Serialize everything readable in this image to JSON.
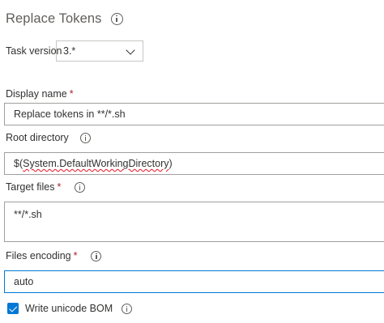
{
  "header": {
    "title": "Replace Tokens",
    "info_icon": "info-icon"
  },
  "task_version": {
    "label": "Task version",
    "value": "3.*",
    "chevron_icon": "chevron-down-icon"
  },
  "display_name": {
    "label": "Display name",
    "required_mark": "*",
    "value": "Replace tokens in **/*.sh"
  },
  "root_directory": {
    "label": "Root directory",
    "value_prefix": "$(",
    "value_misspelled": "System.DefaultWorkingDirectory",
    "value_suffix": ")",
    "info_icon": "info-icon"
  },
  "target_files": {
    "label": "Target files",
    "required_mark": "*",
    "value": "**/*.sh",
    "info_icon": "info-icon"
  },
  "files_encoding": {
    "label": "Files encoding",
    "required_mark": "*",
    "value": "auto",
    "info_icon": "info-icon"
  },
  "write_unicode_bom": {
    "label": "Write unicode BOM",
    "checked": true,
    "info_icon": "info-icon"
  },
  "colors": {
    "accent": "#0078d4",
    "required": "#a4262c",
    "border": "#a19f9d",
    "spellcheck_underline": "#e81123"
  }
}
